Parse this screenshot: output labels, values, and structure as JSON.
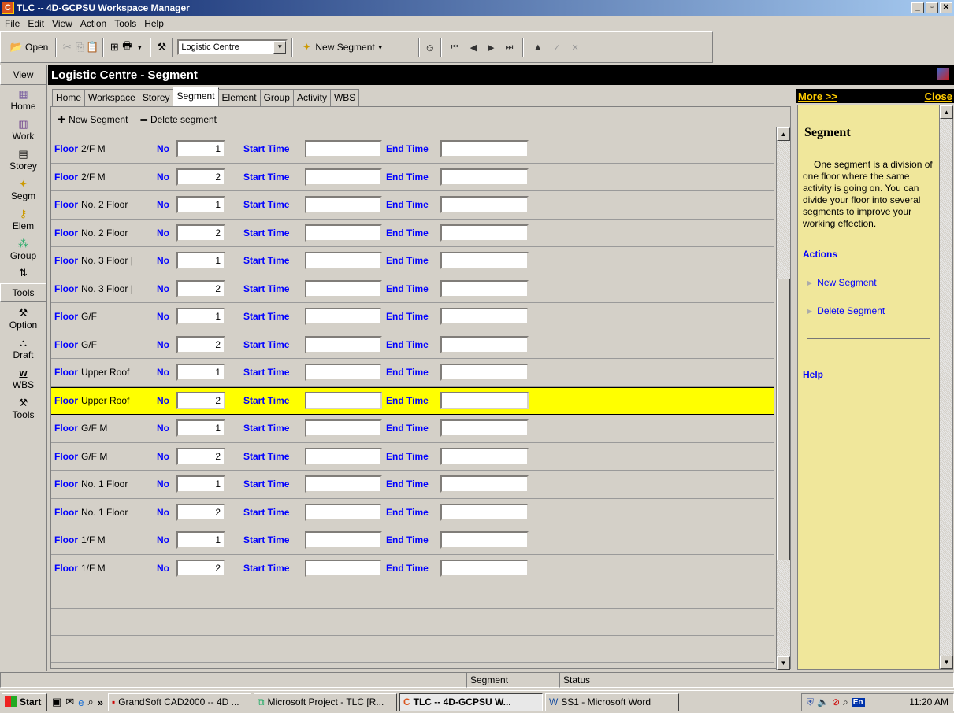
{
  "window": {
    "title": "TLC -- 4D-GCPSU Workspace Manager"
  },
  "menu": [
    "File",
    "Edit",
    "View",
    "Action",
    "Tools",
    "Help"
  ],
  "toolbar": {
    "open_label": "Open",
    "project_combo": "Logistic Centre",
    "new_segment_label": "New Segment"
  },
  "viewbar": {
    "view_label": "View",
    "items": [
      {
        "label": "Home",
        "icon": "calendar-icon"
      },
      {
        "label": "Work",
        "icon": "books-icon"
      },
      {
        "label": "Storey",
        "icon": "pages-icon"
      },
      {
        "label": "Segm",
        "icon": "segment-icon"
      },
      {
        "label": "Elem",
        "icon": "key-icon"
      },
      {
        "label": "Group",
        "icon": "group-icon"
      }
    ],
    "tools_label": "Tools",
    "tool_items": [
      {
        "label": "Option",
        "icon": "option-icon"
      },
      {
        "label": "Draft",
        "icon": "draft-icon"
      },
      {
        "label": "WBS",
        "icon": "wbs-icon"
      },
      {
        "label": "Tools",
        "icon": "tools-icon"
      }
    ]
  },
  "header": {
    "title": "Logistic Centre - Segment"
  },
  "tabs": [
    "Home",
    "Workspace",
    "Storey",
    "Segment",
    "Element",
    "Group",
    "Activity",
    "WBS"
  ],
  "actions": {
    "new_segment": "New Segment",
    "delete_segment": "Delete segment"
  },
  "labels": {
    "floor": "Floor",
    "no": "No",
    "start_time": "Start Time",
    "end_time": "End Time"
  },
  "segments": [
    {
      "floor": "2/F M",
      "no": "1"
    },
    {
      "floor": "2/F M",
      "no": "2"
    },
    {
      "floor": "No. 2 Floor",
      "no": "1"
    },
    {
      "floor": "No. 2 Floor",
      "no": "2"
    },
    {
      "floor": "No. 3 Floor |",
      "no": "1"
    },
    {
      "floor": "No. 3 Floor |",
      "no": "2"
    },
    {
      "floor": "G/F",
      "no": "1"
    },
    {
      "floor": "G/F",
      "no": "2"
    },
    {
      "floor": "Upper Roof",
      "no": "1"
    },
    {
      "floor": "Upper Roof",
      "no": "2"
    },
    {
      "floor": "G/F M",
      "no": "1"
    },
    {
      "floor": "G/F M",
      "no": "2"
    },
    {
      "floor": "No. 1 Floor",
      "no": "1"
    },
    {
      "floor": "No. 1 Floor",
      "no": "2"
    },
    {
      "floor": "1/F M",
      "no": "1"
    },
    {
      "floor": "1/F M",
      "no": "2"
    }
  ],
  "selected_row": 9,
  "task_panel": {
    "more": "More >>",
    "close": "Close",
    "title": "Segment",
    "description": "One segment is a division of one floor where the same activity is going on. You can divide your floor into several segments to improve your working effection.",
    "actions_heading": "Actions",
    "links": [
      "New Segment",
      "Delete Segment"
    ],
    "help": "Help"
  },
  "status": {
    "segment": "Segment",
    "status": "Status"
  },
  "taskbar": {
    "start": "Start",
    "tasks": [
      {
        "label": "GrandSoft CAD2000 -- 4D ...",
        "active": false
      },
      {
        "label": "Microsoft Project - TLC [R...",
        "active": false
      },
      {
        "label": "TLC -- 4D-GCPSU W...",
        "active": true
      },
      {
        "label": "SS1 - Microsoft Word",
        "active": false
      }
    ],
    "lang": "En",
    "clock": "11:20 AM"
  }
}
